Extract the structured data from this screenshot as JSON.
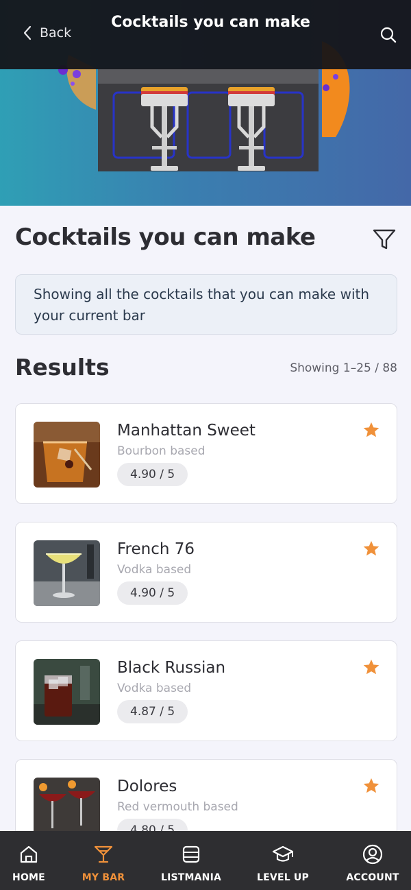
{
  "header": {
    "back_label": "Back",
    "title": "Cocktails you can make",
    "search_icon": "search-icon"
  },
  "page": {
    "heading": "Cocktails you can make",
    "filter_icon": "filter-icon",
    "info_text": "Showing all the cocktails that you can make with your current bar",
    "results_heading": "Results",
    "results_count": "Showing 1–25 / 88"
  },
  "results": [
    {
      "name": "Manhattan Sweet",
      "base": "Bourbon based",
      "rating": "4.90 / 5",
      "favorite": true
    },
    {
      "name": "French 76",
      "base": "Vodka based",
      "rating": "4.90 / 5",
      "favorite": true
    },
    {
      "name": "Black Russian",
      "base": "Vodka based",
      "rating": "4.87 / 5",
      "favorite": true
    },
    {
      "name": "Dolores",
      "base": "Red vermouth based",
      "rating": "4.80 / 5",
      "favorite": true
    }
  ],
  "nav": [
    {
      "label": "HOME",
      "icon": "home-icon",
      "active": false
    },
    {
      "label": "MY BAR",
      "icon": "cocktail-glass-icon",
      "active": true
    },
    {
      "label": "LISTMANIA",
      "icon": "list-icon",
      "active": false
    },
    {
      "label": "LEVEL UP",
      "icon": "graduation-cap-icon",
      "active": false
    },
    {
      "label": "ACCOUNT",
      "icon": "user-icon",
      "active": false
    }
  ],
  "colors": {
    "accent": "#f0913a",
    "topbar": "#141418",
    "bottomnav": "#2e2e31"
  }
}
